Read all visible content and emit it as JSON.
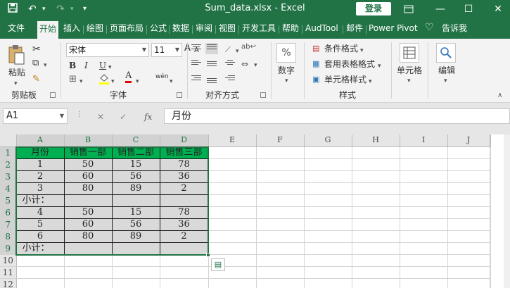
{
  "titlebar": {
    "save_icon": "save-icon",
    "undo_icon": "undo-icon",
    "redo_icon": "redo-icon",
    "customize_icon": "chevron-down-icon",
    "title": "Sum_data.xlsx  -  Excel",
    "login_label": "登录",
    "ribbon_display_icon": "ribbon-display-icon",
    "minimize_icon": "minimize-icon",
    "maximize_icon": "maximize-icon",
    "close_icon": "close-icon"
  },
  "tabs": [
    "文件",
    "开始",
    "插入",
    "绘图",
    "页面布局",
    "公式",
    "数据",
    "审阅",
    "视图",
    "开发工具",
    "帮助",
    "AudTool",
    "邮件",
    "Power Pivot"
  ],
  "active_tab": "开始",
  "tellme_label": "告诉我",
  "ribbon": {
    "clipboard": {
      "paste_label": "粘贴",
      "group_label": "剪贴板"
    },
    "font": {
      "font_name": "宋体",
      "font_size": "11",
      "bold": "B",
      "italic": "I",
      "underline": "U",
      "grow": "A",
      "shrink": "A",
      "color_a": "A",
      "phonetic": "wén",
      "group_label": "字体"
    },
    "alignment": {
      "group_label": "对齐方式"
    },
    "number": {
      "label": "数字",
      "icon_text": "%"
    },
    "styles": {
      "conditional": "条件格式",
      "table": "套用表格格式",
      "cell_styles": "单元格样式",
      "group_label": "样式"
    },
    "cells": {
      "label": "单元格"
    },
    "editing": {
      "label": "编辑"
    }
  },
  "formula_bar": {
    "name_box": "A1",
    "cancel": "✕",
    "enter": "✓",
    "fx": "fx",
    "content": "月份"
  },
  "columns": [
    "A",
    "B",
    "C",
    "D",
    "E",
    "F",
    "G",
    "H",
    "I",
    "J"
  ],
  "rows": [
    "1",
    "2",
    "3",
    "4",
    "5",
    "6",
    "7",
    "8",
    "9",
    "10",
    "11",
    "12"
  ],
  "cells": [
    [
      "月份",
      "销售一部",
      "销售二部",
      "销售三部"
    ],
    [
      "1",
      "50",
      "15",
      "78"
    ],
    [
      "2",
      "60",
      "56",
      "36"
    ],
    [
      "3",
      "80",
      "89",
      "2"
    ],
    [
      "小计：",
      "",
      "",
      ""
    ],
    [
      "4",
      "50",
      "15",
      "78"
    ],
    [
      "5",
      "60",
      "56",
      "36"
    ],
    [
      "6",
      "80",
      "89",
      "2"
    ],
    [
      "小计：",
      "",
      "",
      ""
    ]
  ],
  "colors": {
    "excel_green": "#217346",
    "header_fill": "#00b050",
    "data_fill": "#d9d9d9"
  }
}
